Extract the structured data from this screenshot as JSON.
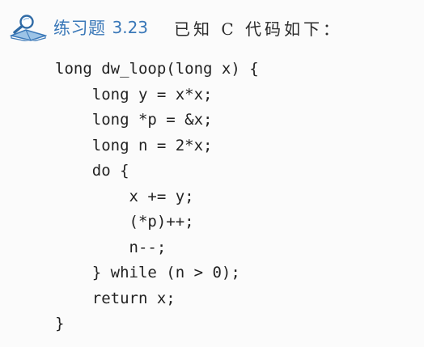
{
  "heading": {
    "label": "练习题",
    "number": "3.23",
    "text": "已知 C 代码如下："
  },
  "code": {
    "lines": [
      "long dw_loop(long x) {",
      "    long y = x*x;",
      "    long *p = &x;",
      "    long n = 2*x;",
      "    do {",
      "        x += y;",
      "        (*p)++;",
      "        n--;",
      "    } while (n > 0);",
      "    return x;",
      "}"
    ]
  },
  "colors": {
    "accent": "#3a78b8",
    "text": "#222222",
    "background": "#fbfbfb"
  },
  "icons": {
    "exercise": "magnifier-book-icon"
  }
}
